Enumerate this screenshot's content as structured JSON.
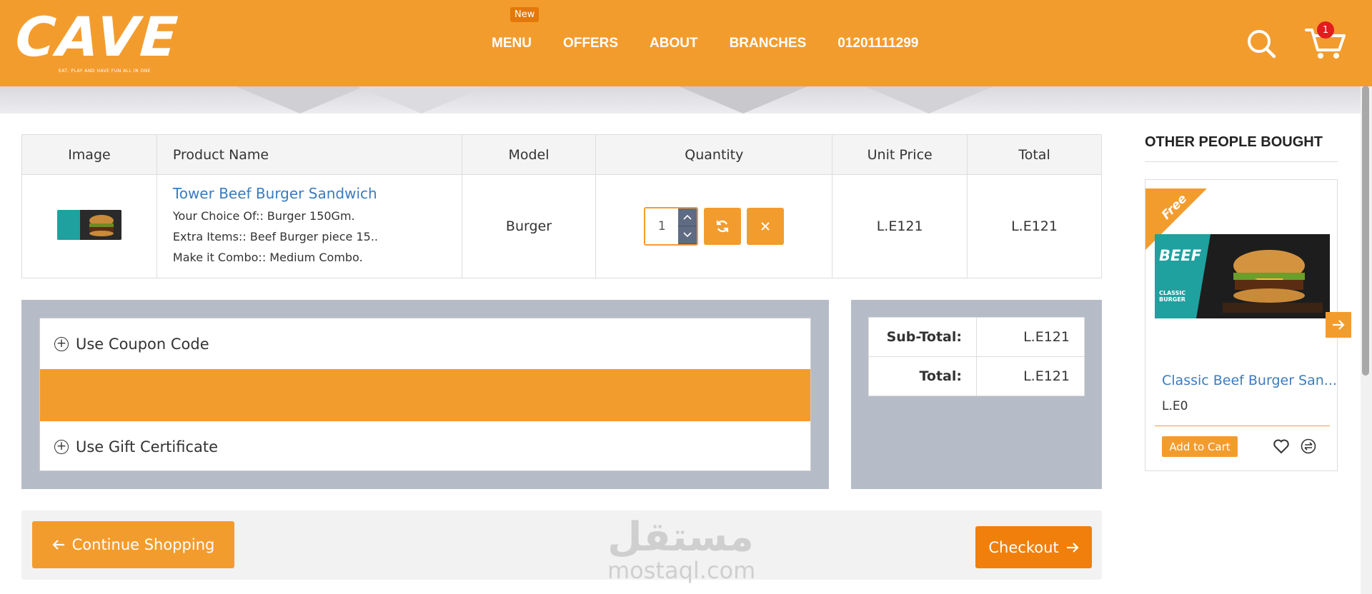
{
  "header": {
    "logo": "CAVE",
    "tagline": "EAT, PLAY AND HAVE FUN ALL IN ONE",
    "nav": [
      {
        "label": "MENU",
        "badge": "New"
      },
      {
        "label": "OFFERS"
      },
      {
        "label": "ABOUT"
      },
      {
        "label": "BRANCHES"
      },
      {
        "label": "01201111299"
      }
    ],
    "cart_count": "1",
    "icons": [
      "search-icon",
      "cart-icon"
    ]
  },
  "cart_table": {
    "columns": [
      "Image",
      "Product Name",
      "Model",
      "Quantity",
      "Unit Price",
      "Total"
    ],
    "rows": [
      {
        "name": "Tower Beef Burger Sandwich",
        "options": [
          "Your Choice Of:: Burger 150Gm.",
          "Extra Items:: Beef Burger piece 15..",
          "Make it Combo:: Medium Combo."
        ],
        "model": "Burger",
        "quantity": "1",
        "unit_price": "L.E121",
        "total": "L.E121"
      }
    ]
  },
  "coupon": {
    "coupon_label": "Use Coupon Code",
    "gift_label": "Use Gift Certificate"
  },
  "totals": {
    "subtotal_label": "Sub-Total:",
    "subtotal_value": "L.E121",
    "total_label": "Total:",
    "total_value": "L.E121"
  },
  "actions": {
    "continue_label": "Continue Shopping",
    "checkout_label": "Checkout"
  },
  "watermark": {
    "arabic": "مستقل",
    "latin": "mostaql.com"
  },
  "sidebar": {
    "title": "OTHER PEOPLE BOUGHT",
    "product": {
      "ribbon": "Free",
      "name": "Classic Beef Burger San...",
      "price": "L.E0",
      "add_label": "Add to Cart",
      "image_text": "BEEF",
      "image_subtext": "CLASSIC BURGER"
    }
  },
  "colors": {
    "brand_orange": "#f39c2e",
    "checkout_orange": "#f07f0c",
    "link_blue": "#3a7bbf",
    "panel_gray": "#b6bcc7"
  }
}
